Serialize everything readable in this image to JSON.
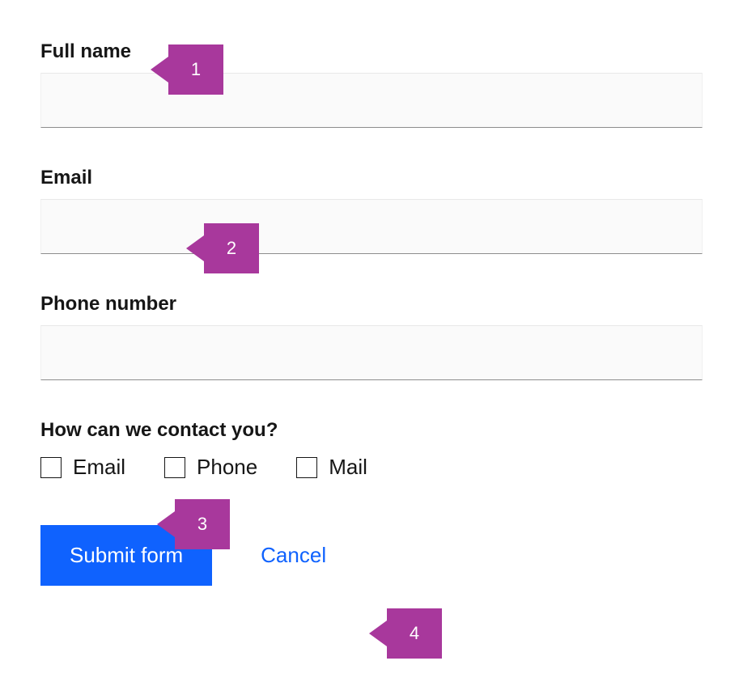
{
  "fields": {
    "fullName": {
      "label": "Full name",
      "value": ""
    },
    "email": {
      "label": "Email",
      "value": ""
    },
    "phone": {
      "label": "Phone number",
      "value": ""
    }
  },
  "contact": {
    "label": "How can we contact you?",
    "options": {
      "email": "Email",
      "phone": "Phone",
      "mail": "Mail"
    }
  },
  "buttons": {
    "submit": "Submit form",
    "cancel": "Cancel"
  },
  "annotations": {
    "a1": "1",
    "a2": "2",
    "a3": "3",
    "a4": "4"
  }
}
